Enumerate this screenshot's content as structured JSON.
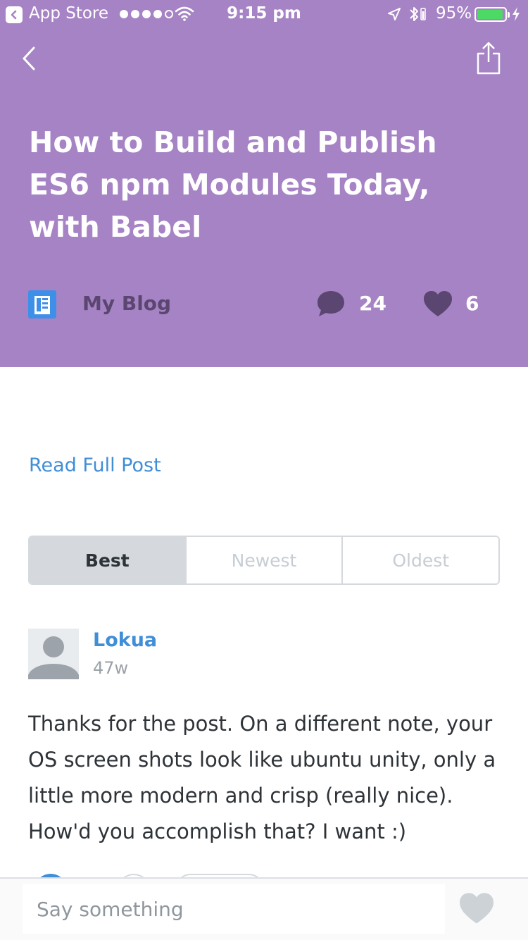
{
  "status_bar": {
    "back_app": "App Store",
    "time": "9:15 pm",
    "battery_percent": "95%",
    "battery_level": 0.95
  },
  "post": {
    "title": "How to Build and Publish ES6 npm Modules Today, with Babel",
    "blog_name": "My Blog",
    "comment_count": "24",
    "like_count": "6"
  },
  "read_full_post": "Read Full Post",
  "sort_tabs": [
    {
      "label": "Best",
      "active": true
    },
    {
      "label": "Newest",
      "active": false
    },
    {
      "label": "Oldest",
      "active": false
    }
  ],
  "comments": [
    {
      "author": "Lokua",
      "time": "47w",
      "text": "Thanks for the post. On a different note, your OS screen shots look like ubuntu unity, only a little more modern and crisp (really nice). How'd you accomplish that? I want :)"
    }
  ],
  "composer": {
    "placeholder": "Say something"
  },
  "colors": {
    "header_bg": "#a683c4",
    "link": "#3f8ed8",
    "blog_icon": "#3d8fe8",
    "meta_dark": "#5a4670",
    "battery_fill": "#4cd964"
  },
  "icons": [
    "app-store-back-icon",
    "signal-dots-icon",
    "wifi-icon",
    "location-arrow-icon",
    "bluetooth-icon",
    "battery-icon",
    "charging-bolt-icon",
    "back-chevron-icon",
    "share-icon",
    "blog-icon",
    "comment-bubble-icon",
    "heart-icon",
    "avatar-placeholder-icon"
  ]
}
